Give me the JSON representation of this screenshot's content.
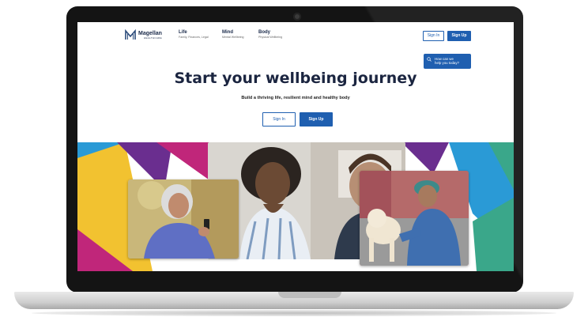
{
  "brand": {
    "name": "Magellan",
    "sub": "HEALTHCARE"
  },
  "nav": [
    {
      "title": "Life",
      "sub": "Family, Finances, Legal"
    },
    {
      "title": "Mind",
      "sub": "Mental Wellbeing"
    },
    {
      "title": "Body",
      "sub": "Physical Wellbeing"
    }
  ],
  "header": {
    "signin": "Sign In",
    "signup": "Sign Up"
  },
  "help": {
    "line1": "How can we",
    "line2": "help you today?"
  },
  "hero": {
    "title": "Start your wellbeing journey",
    "subtitle": "Build a thriving life, resilient mind and healthy body",
    "signin": "Sign In",
    "signup": "Sign Up"
  },
  "colors": {
    "primary": "#1f5fb0",
    "navy": "#1b2540",
    "accent_yellow": "#f2c230",
    "accent_purple": "#6a2e8f",
    "accent_magenta": "#c0267a",
    "accent_blue": "#2a9ad6",
    "accent_green": "#3aa78a"
  }
}
